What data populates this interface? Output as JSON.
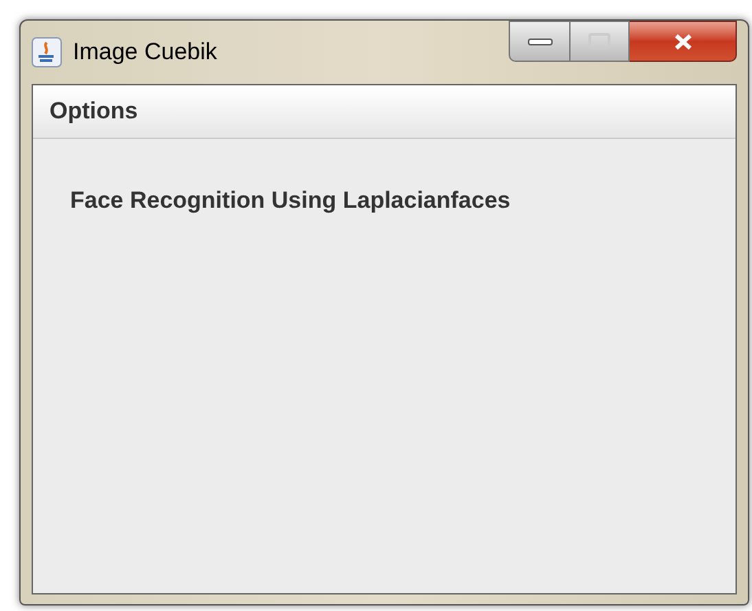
{
  "window": {
    "title": "Image Cuebik"
  },
  "menu_bar": {
    "items": [
      {
        "label": "Options"
      }
    ]
  },
  "content": {
    "heading": "Face Recognition Using Laplacianfaces"
  }
}
